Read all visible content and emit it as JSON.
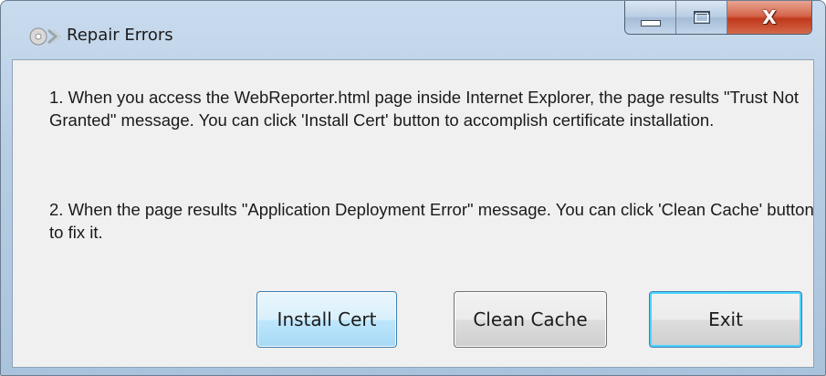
{
  "window": {
    "title": "Repair Errors",
    "app_icon": "cd-icon"
  },
  "caption_buttons": {
    "minimize_icon": "minimize-icon",
    "maximize_icon": "maximize-icon",
    "close_icon": "close-icon",
    "close_glyph": "X"
  },
  "messages": [
    {
      "text": "1. When you access the WebReporter.html page inside Internet Explorer, the page results \"Trust Not Granted\" message. You can click 'Install Cert' button to accomplish certificate installation."
    },
    {
      "text": "2. When the page results \"Application Deployment Error\" message. You can click 'Clean Cache' button to fix it."
    }
  ],
  "buttons": {
    "install_cert": "Install Cert",
    "clean_cache": "Clean Cache",
    "exit": "Exit"
  },
  "colors": {
    "close_button": "#c0391b",
    "focus_highlight": "#48d3ff",
    "window_frame": "#b7cde4",
    "client_background": "#f0f0f0"
  }
}
